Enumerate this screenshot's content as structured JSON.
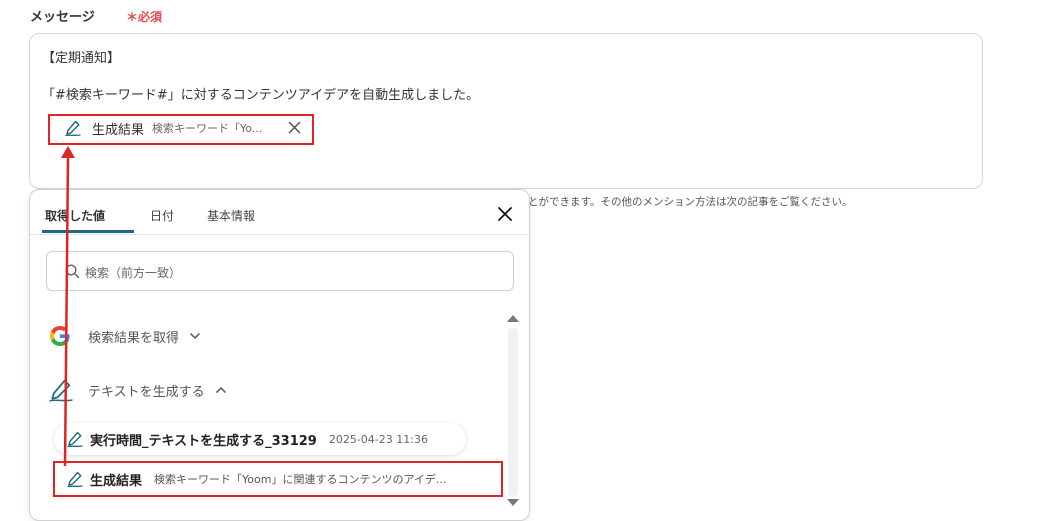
{
  "field": {
    "label": "メッセージ",
    "required": "＊必須"
  },
  "message": {
    "line1": "【定期通知】",
    "line2": "「#検索キーワード#」に対するコンテンツアイデアを自動生成しました。",
    "chip": {
      "title": "生成結果",
      "subtitle": "検索キーワード「Yo..."
    }
  },
  "helper_text": "とができます。その他のメンション方法は次の記事をご覧ください。",
  "dropdown": {
    "tabs": [
      {
        "label": "取得した値"
      },
      {
        "label": "日付"
      },
      {
        "label": "基本情報"
      }
    ],
    "search_placeholder": "検索（前方一致）",
    "sections": [
      {
        "label": "検索結果を取得",
        "expanded": false,
        "icon": "google-icon"
      },
      {
        "label": "テキストを生成する",
        "expanded": true,
        "icon": "pen-icon"
      }
    ],
    "run_item": {
      "title": "実行時間_テキストを生成する_33129",
      "time": "2025-04-23 11:36"
    },
    "result_item": {
      "title": "生成結果",
      "subtitle": "検索キーワード「Yoom」に関連するコンテンツのアイデ..."
    }
  },
  "colors": {
    "accent": "#1d6b7c",
    "highlight": "#e02424",
    "required": "#e5484d"
  }
}
